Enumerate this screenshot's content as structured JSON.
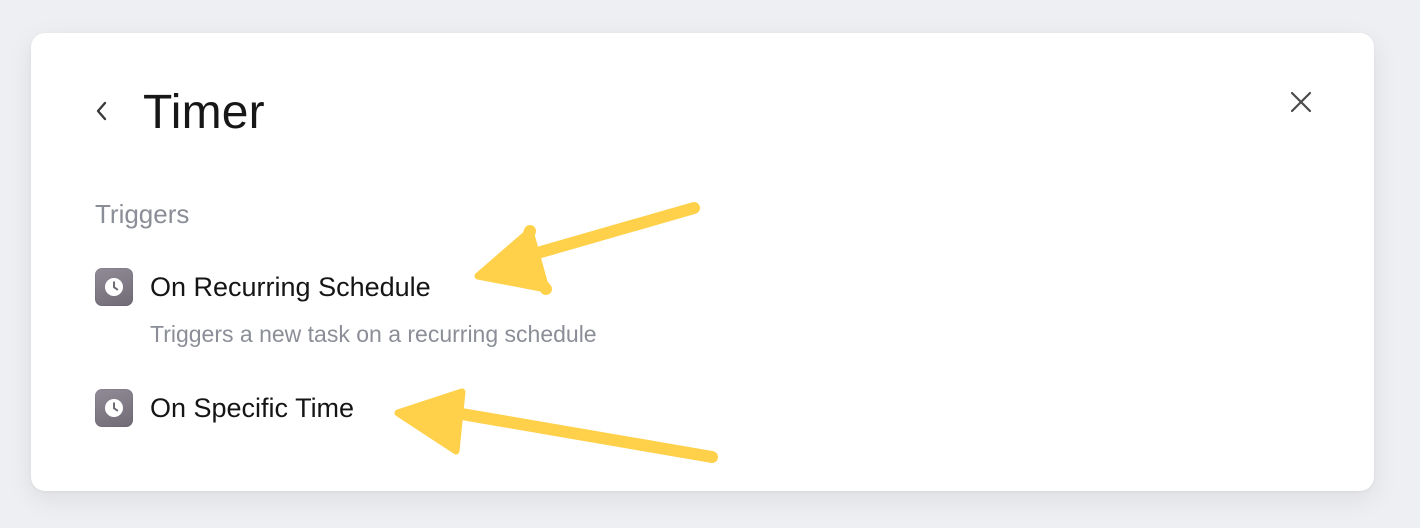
{
  "header": {
    "title": "Timer"
  },
  "section": {
    "label": "Triggers"
  },
  "triggers": [
    {
      "title": "On Recurring Schedule",
      "description": "Triggers a new task on a recurring schedule",
      "icon": "clock-icon"
    },
    {
      "title": "On Specific Time",
      "description": "",
      "icon": "clock-icon"
    }
  ],
  "colors": {
    "annotation": "#ffd14a",
    "icon_bg": "#7d7882",
    "muted_text": "#8b8e97"
  }
}
